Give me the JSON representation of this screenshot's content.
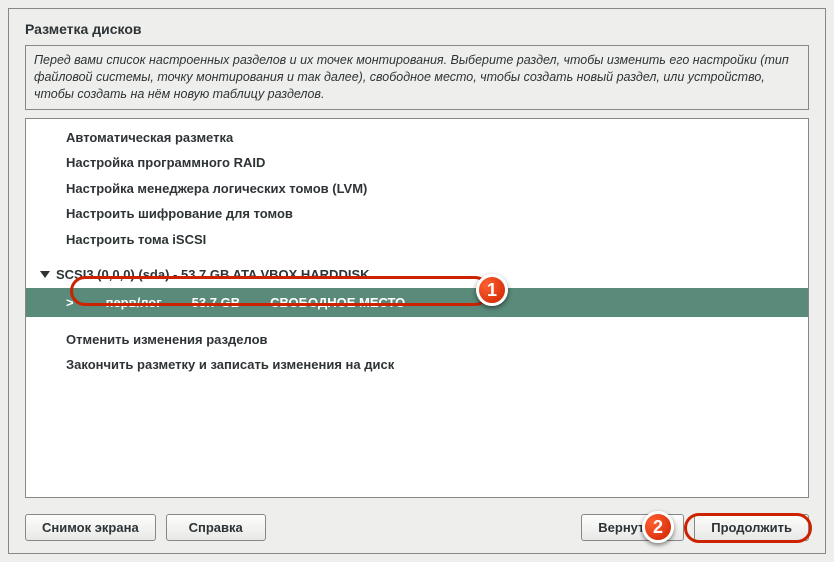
{
  "window": {
    "title": "Разметка дисков"
  },
  "description": "Перед вами список настроенных разделов и их точек монтирования. Выберите раздел, чтобы изменить его настройки (тип файловой системы, точку монтирования и так далее), свободное место, чтобы создать новый раздел, или устройство, чтобы создать на нём новую таблицу разделов.",
  "menu": {
    "guided": "Автоматическая разметка",
    "raid": "Настройка программного RAID",
    "lvm": "Настройка менеджера логических томов (LVM)",
    "encrypt": "Настроить шифрование для томов",
    "iscsi": "Настроить тома iSCSI"
  },
  "disk": {
    "header": "SCSI3 (0,0,0) (sda) - 53.7 GB ATA VBOX HARDDISK",
    "partition": {
      "arrow": ">",
      "type": "перв/лог",
      "size": "53.7 GB",
      "label": "СВОБОДНОЕ МЕСТО"
    }
  },
  "actions": {
    "undo": "Отменить изменения разделов",
    "finish": "Закончить разметку и записать изменения на диск"
  },
  "buttons": {
    "screenshot": "Снимок экрана",
    "help": "Справка",
    "back": "Вернуться",
    "continue": "Продолжить"
  },
  "callouts": {
    "one": "1",
    "two": "2"
  }
}
